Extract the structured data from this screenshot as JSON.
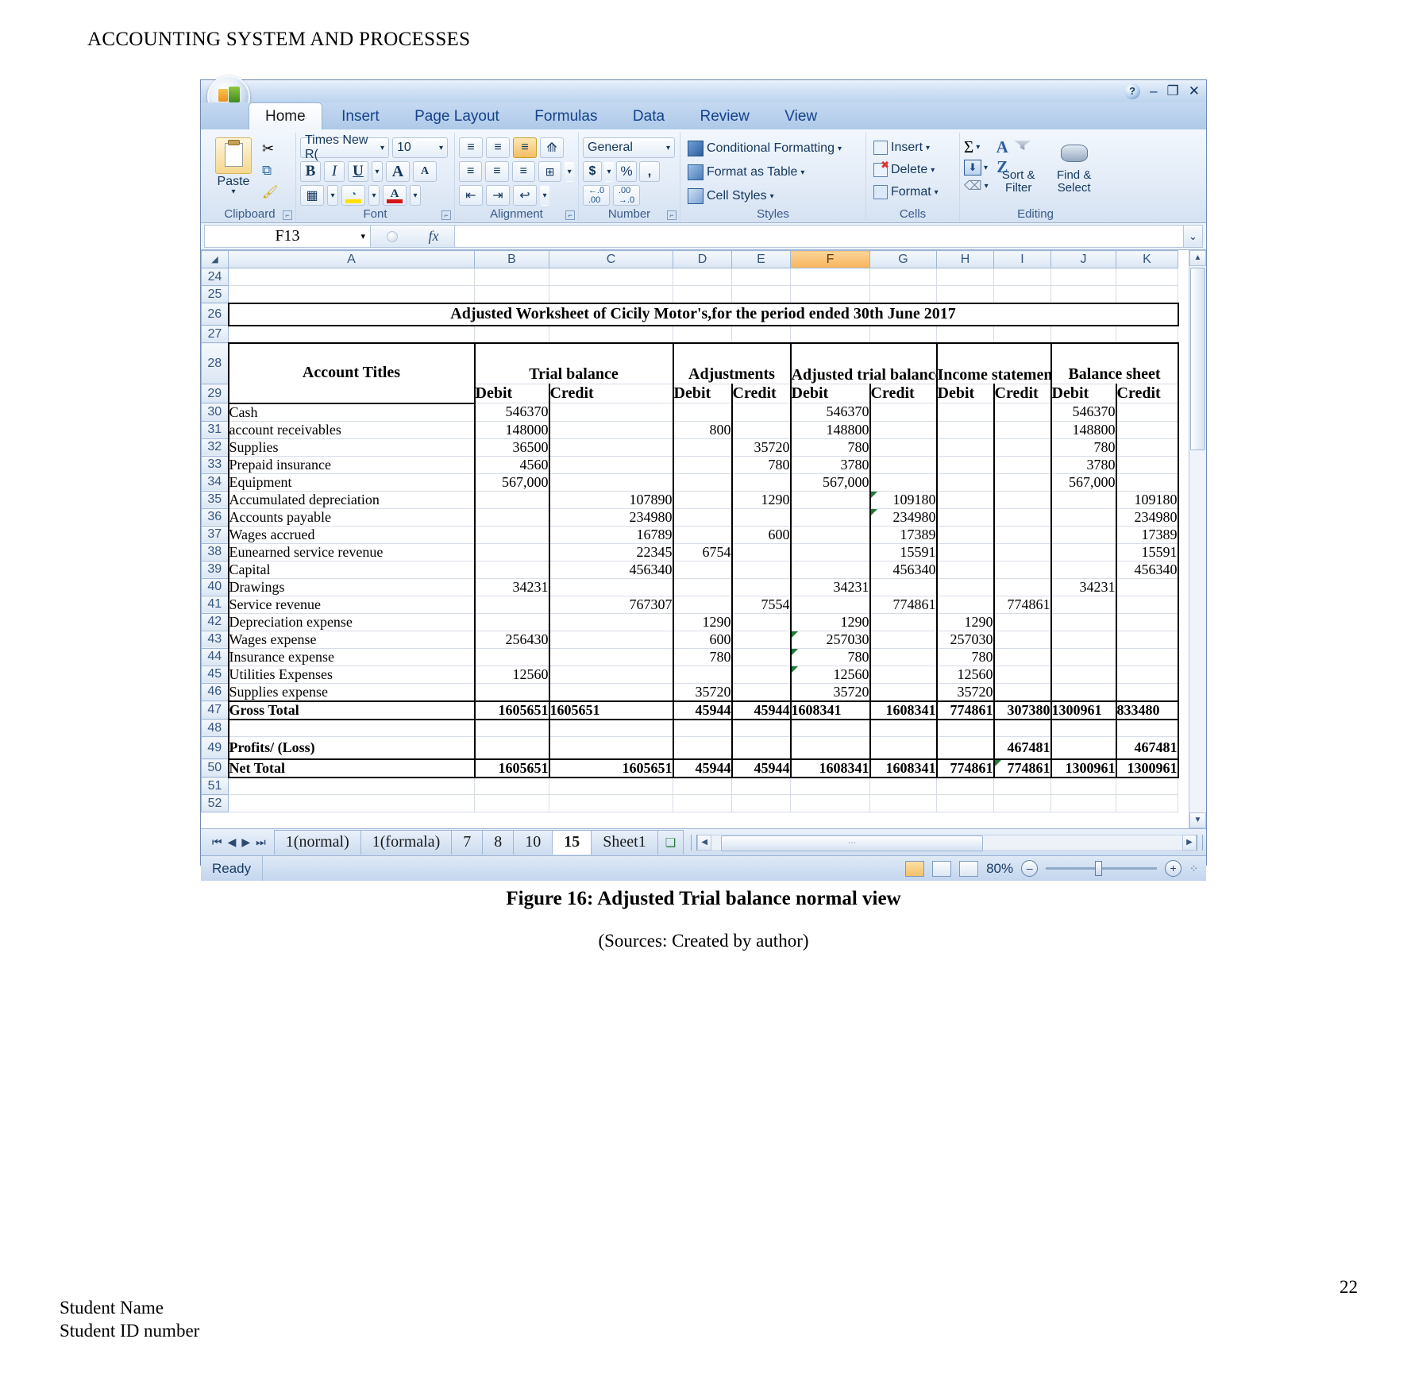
{
  "document": {
    "header": "ACCOUNTING SYSTEM AND PROCESSES",
    "figure_caption": "Figure 16: Adjusted Trial balance normal view",
    "figure_source": "(Sources: Created by author)",
    "page_number": "22",
    "footer_line1": "Student Name",
    "footer_line2": "Student ID number"
  },
  "window": {
    "help_glyph": "?",
    "minimize_glyph": "–",
    "restore_glyph": "❐",
    "close_glyph": "✕",
    "office_button": "office-orb"
  },
  "ribbon": {
    "tabs": [
      {
        "label": "Home",
        "active": true
      },
      {
        "label": "Insert",
        "active": false
      },
      {
        "label": "Page Layout",
        "active": false
      },
      {
        "label": "Formulas",
        "active": false
      },
      {
        "label": "Data",
        "active": false
      },
      {
        "label": "Review",
        "active": false
      },
      {
        "label": "View",
        "active": false
      }
    ],
    "groups": {
      "clipboard": {
        "label": "Clipboard",
        "paste": "Paste",
        "paste_caret": "▾",
        "cut": "✂",
        "copy": "⧉",
        "format_painter": "🖌"
      },
      "font": {
        "label": "Font",
        "font_name": "Times New R(",
        "font_size": "10",
        "bold": "B",
        "italic": "I",
        "underline": "U",
        "grow_font": "A",
        "shrink_font": "A",
        "borders": "▦",
        "fill_color": "A",
        "font_color": "A",
        "caret": "▾"
      },
      "alignment": {
        "label": "Alignment",
        "align_top": "≡",
        "align_middle": "≡",
        "align_bottom": "≡",
        "orientation": "⟰",
        "align_left": "≡",
        "align_center": "≡",
        "align_right": "≡",
        "merge_center": "⊞",
        "decrease_indent": "⇤",
        "increase_indent": "⇥",
        "wrap_text": "↩"
      },
      "number": {
        "label": "Number",
        "format": "General",
        "currency": "$",
        "percent": "%",
        "comma": ",",
        "increase_decimal": ".00",
        "decrease_decimal": ".00",
        "caret": "▾"
      },
      "styles": {
        "label": "Styles",
        "conditional_formatting": "Conditional Formatting",
        "format_as_table": "Format as Table",
        "cell_styles": "Cell Styles",
        "caret": "▾"
      },
      "cells": {
        "label": "Cells",
        "insert": "Insert",
        "delete": "Delete",
        "format": "Format",
        "caret": "▾"
      },
      "editing": {
        "label": "Editing",
        "autosum": "Σ",
        "fill": "⬇",
        "clear": "⌫",
        "sort_filter_line1": "Sort &",
        "sort_filter_line2": "Filter",
        "find_select_line1": "Find &",
        "find_select_line2": "Select",
        "caret": "▾"
      }
    }
  },
  "formula_bar": {
    "name_box": "F13",
    "name_box_caret": "▾",
    "fx_label": "fx",
    "formula_value": "",
    "expand_caret": "⌄"
  },
  "grid": {
    "selected_column": "F",
    "columns": [
      "A",
      "B",
      "C",
      "D",
      "E",
      "F",
      "G",
      "H",
      "I",
      "J",
      "K"
    ],
    "row_numbers": [
      "24",
      "25",
      "26",
      "27",
      "28",
      "29",
      "30",
      "31",
      "32",
      "33",
      "34",
      "35",
      "36",
      "37",
      "38",
      "39",
      "40",
      "41",
      "42",
      "43",
      "44",
      "45",
      "46",
      "47",
      "48",
      "49",
      "50",
      "51",
      "52"
    ],
    "title_row": {
      "row": "26",
      "text": "Adjusted Worksheet of Cicily Motor's,for the period ended 30th June 2017"
    },
    "header_group_row": {
      "row": "28",
      "account_titles": "Account Titles",
      "groups": [
        "Trial balance",
        "Adjustments",
        "Adjusted trial balance",
        "Income statement",
        "Balance sheet"
      ]
    },
    "header_sub_row": {
      "row": "29",
      "labels": [
        "Debit",
        "Credit",
        "Debit",
        "Credit",
        "Debit",
        "Credit",
        "Debit",
        "Credit",
        "Debit",
        "Credit"
      ]
    },
    "rows": [
      {
        "row": "30",
        "account": "Cash",
        "tb_d": "546370",
        "tb_c": "",
        "adj_d": "",
        "adj_c": "",
        "atb_d": "546370",
        "atb_c": "",
        "is_d": "",
        "is_c": "",
        "bs_d": "546370",
        "bs_c": ""
      },
      {
        "row": "31",
        "account": "account receivables",
        "tb_d": "148000",
        "tb_c": "",
        "adj_d": "800",
        "adj_c": "",
        "atb_d": "148800",
        "atb_c": "",
        "is_d": "",
        "is_c": "",
        "bs_d": "148800",
        "bs_c": ""
      },
      {
        "row": "32",
        "account": "Supplies",
        "tb_d": "36500",
        "tb_c": "",
        "adj_d": "",
        "adj_c": "35720",
        "atb_d": "780",
        "atb_c": "",
        "is_d": "",
        "is_c": "",
        "bs_d": "780",
        "bs_c": ""
      },
      {
        "row": "33",
        "account": "Prepaid insurance",
        "tb_d": "4560",
        "tb_c": "",
        "adj_d": "",
        "adj_c": "780",
        "atb_d": "3780",
        "atb_c": "",
        "is_d": "",
        "is_c": "",
        "bs_d": "3780",
        "bs_c": ""
      },
      {
        "row": "34",
        "account": "Equipment",
        "tb_d": "567,000",
        "tb_c": "",
        "adj_d": "",
        "adj_c": "",
        "atb_d": "567,000",
        "atb_c": "",
        "is_d": "",
        "is_c": "",
        "bs_d": "567,000",
        "bs_c": ""
      },
      {
        "row": "35",
        "account": "Accumulated depreciation",
        "tb_d": "",
        "tb_c": "107890",
        "adj_d": "",
        "adj_c": "1290",
        "atb_d": "",
        "atb_c": "109180",
        "is_d": "",
        "is_c": "",
        "bs_d": "",
        "bs_c": "109180"
      },
      {
        "row": "36",
        "account": "Accounts payable",
        "tb_d": "",
        "tb_c": "234980",
        "adj_d": "",
        "adj_c": "",
        "atb_d": "",
        "atb_c": "234980",
        "is_d": "",
        "is_c": "",
        "bs_d": "",
        "bs_c": "234980"
      },
      {
        "row": "37",
        "account": "Wages accrued",
        "tb_d": "",
        "tb_c": "16789",
        "adj_d": "",
        "adj_c": "600",
        "atb_d": "",
        "atb_c": "17389",
        "is_d": "",
        "is_c": "",
        "bs_d": "",
        "bs_c": "17389"
      },
      {
        "row": "38",
        "account": "Eunearned service revenue",
        "tb_d": "",
        "tb_c": "22345",
        "adj_d": "6754",
        "adj_c": "",
        "atb_d": "",
        "atb_c": "15591",
        "is_d": "",
        "is_c": "",
        "bs_d": "",
        "bs_c": "15591"
      },
      {
        "row": "39",
        "account": "Capital",
        "tb_d": "",
        "tb_c": "456340",
        "adj_d": "",
        "adj_c": "",
        "atb_d": "",
        "atb_c": "456340",
        "is_d": "",
        "is_c": "",
        "bs_d": "",
        "bs_c": "456340"
      },
      {
        "row": "40",
        "account": "Drawings",
        "tb_d": "34231",
        "tb_c": "",
        "adj_d": "",
        "adj_c": "",
        "atb_d": "34231",
        "atb_c": "",
        "is_d": "",
        "is_c": "",
        "bs_d": "34231",
        "bs_c": ""
      },
      {
        "row": "41",
        "account": "Service revenue",
        "tb_d": "",
        "tb_c": "767307",
        "adj_d": "",
        "adj_c": "7554",
        "atb_d": "",
        "atb_c": "774861",
        "is_d": "",
        "is_c": "774861",
        "bs_d": "",
        "bs_c": ""
      },
      {
        "row": "42",
        "account": "Depreciation expense",
        "tb_d": "",
        "tb_c": "",
        "adj_d": "1290",
        "adj_c": "",
        "atb_d": "1290",
        "atb_c": "",
        "is_d": "1290",
        "is_c": "",
        "bs_d": "",
        "bs_c": ""
      },
      {
        "row": "43",
        "account": "Wages expense",
        "tb_d": "256430",
        "tb_c": "",
        "adj_d": "600",
        "adj_c": "",
        "atb_d": "257030",
        "atb_c": "",
        "is_d": "257030",
        "is_c": "",
        "bs_d": "",
        "bs_c": ""
      },
      {
        "row": "44",
        "account": "Insurance expense",
        "tb_d": "",
        "tb_c": "",
        "adj_d": "780",
        "adj_c": "",
        "atb_d": "780",
        "atb_c": "",
        "is_d": "780",
        "is_c": "",
        "bs_d": "",
        "bs_c": ""
      },
      {
        "row": "45",
        "account": "Utilities Expenses",
        "tb_d": "12560",
        "tb_c": "",
        "adj_d": "",
        "adj_c": "",
        "atb_d": "12560",
        "atb_c": "",
        "is_d": "12560",
        "is_c": "",
        "bs_d": "",
        "bs_c": ""
      },
      {
        "row": "46",
        "account": "Supplies expense",
        "tb_d": "",
        "tb_c": "",
        "adj_d": "35720",
        "adj_c": "",
        "atb_d": "35720",
        "atb_c": "",
        "is_d": "35720",
        "is_c": "",
        "bs_d": "",
        "bs_c": ""
      }
    ],
    "gross_total": {
      "row": "47",
      "account": "Gross Total",
      "tb_d": "1605651",
      "tb_c": "1605651",
      "adj_d": "45944",
      "adj_c": "45944",
      "atb_d": "1608341",
      "atb_c": "1608341",
      "is_d": "774861",
      "is_c": "307380",
      "bs_d": "1300961",
      "bs_c": "833480"
    },
    "blank_row": {
      "row": "48"
    },
    "profit_loss": {
      "row": "49",
      "account": "Profits/ (Loss)",
      "tb_d": "",
      "tb_c": "",
      "adj_d": "",
      "adj_c": "",
      "atb_d": "",
      "atb_c": "",
      "is_d": "",
      "is_c": "467481",
      "bs_d": "",
      "bs_c": "467481"
    },
    "net_total": {
      "row": "50",
      "account": "Net Total",
      "tb_d": "1605651",
      "tb_c": "1605651",
      "adj_d": "45944",
      "adj_c": "45944",
      "atb_d": "1608341",
      "atb_c": "1608341",
      "is_d": "774861",
      "is_c": "774861",
      "bs_d": "1300961",
      "bs_c": "1300961"
    },
    "trailing_rows": [
      "51",
      "52"
    ]
  },
  "sheet_tabs": {
    "nav_first": "⏮",
    "nav_prev": "◀",
    "nav_next": "▶",
    "nav_last": "⏭",
    "tabs": [
      {
        "label": "1(normal)",
        "active": false
      },
      {
        "label": "1(formala)",
        "active": false
      },
      {
        "label": "7",
        "active": false
      },
      {
        "label": "8",
        "active": false
      },
      {
        "label": "10",
        "active": false
      },
      {
        "label": "15",
        "active": true
      },
      {
        "label": "Sheet1",
        "active": false
      }
    ],
    "new_sheet_icon": "insert-worksheet-icon"
  },
  "status_bar": {
    "status": "Ready",
    "view_normal": "normal-view-icon",
    "view_page_layout": "page-layout-view-icon",
    "view_page_break": "page-break-view-icon",
    "zoom_level": "80%",
    "zoom_out": "–",
    "zoom_in": "+",
    "resize_grip": "⁘"
  }
}
